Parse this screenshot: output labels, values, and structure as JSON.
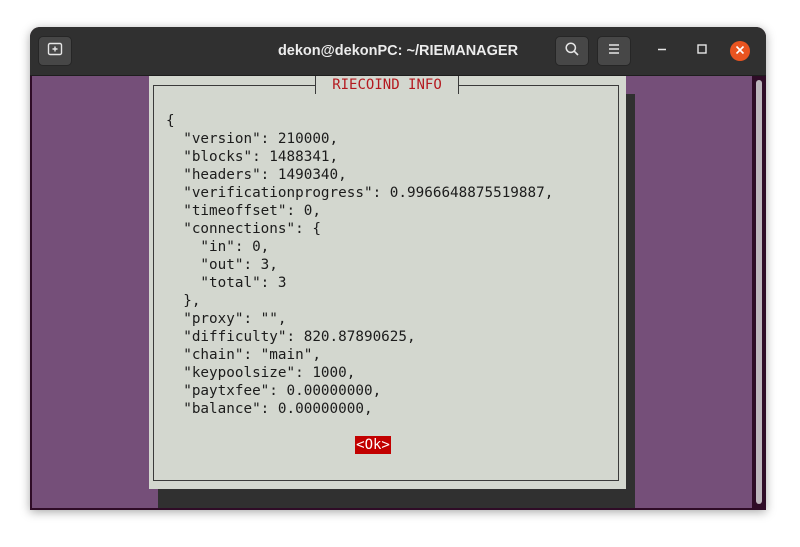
{
  "window": {
    "title": "dekon@dekonPC: ~/RIEMANAGER"
  },
  "titlebar": {
    "new_tab_icon": "new-tab-icon",
    "search_icon": "search-icon",
    "menu_icon": "hamburger-menu-icon",
    "minimize_icon": "minimize-icon",
    "maximize_icon": "maximize-icon",
    "close_icon": "close-icon"
  },
  "dialog": {
    "title": "RIECOIND INFO",
    "content": "{\n  \"version\": 210000,\n  \"blocks\": 1488341,\n  \"headers\": 1490340,\n  \"verificationprogress\": 0.9966648875519887,\n  \"timeoffset\": 0,\n  \"connections\": {\n    \"in\": 0,\n    \"out\": 3,\n    \"total\": 3\n  },\n  \"proxy\": \"\",\n  \"difficulty\": 820.87890625,\n  \"chain\": \"main\",\n  \"keypoolsize\": 1000,\n  \"paytxfee\": 0.00000000,\n  \"balance\": 0.00000000,",
    "ok_label": "<Ok>"
  },
  "colors": {
    "titlebar": "#303030",
    "terminal_bg": "#754f79",
    "dialog_bg": "#d3d7cf",
    "dialog_title": "#b4191f",
    "ok_button": "#c20000",
    "close_button": "#e95420"
  }
}
